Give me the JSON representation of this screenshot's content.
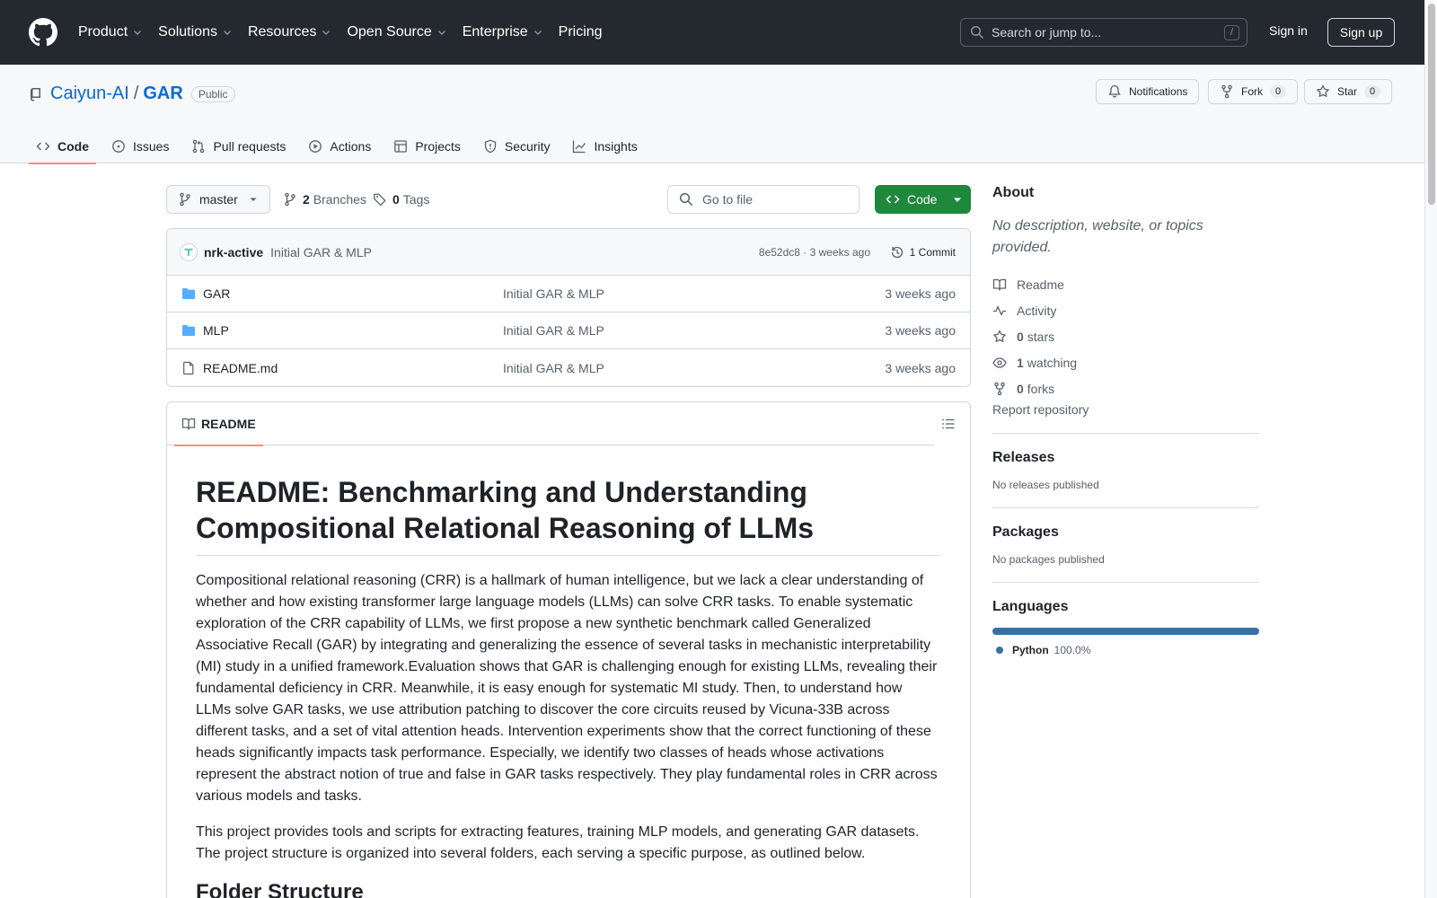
{
  "header": {
    "nav": [
      "Product",
      "Solutions",
      "Resources",
      "Open Source",
      "Enterprise",
      "Pricing"
    ],
    "search_placeholder": "Search or jump to...",
    "search_key": "/",
    "signin": "Sign in",
    "signup": "Sign up"
  },
  "repo": {
    "owner": "Caiyun-AI",
    "separator": "/",
    "name": "GAR",
    "visibility": "Public",
    "notifications": "Notifications",
    "fork_label": "Fork",
    "fork_count": "0",
    "star_label": "Star",
    "star_count": "0",
    "tabs": [
      "Code",
      "Issues",
      "Pull requests",
      "Actions",
      "Projects",
      "Security",
      "Insights"
    ]
  },
  "toolbar": {
    "branch": "master",
    "branches_count": "2",
    "branches_label": "Branches",
    "tags_count": "0",
    "tags_label": "Tags",
    "goto_placeholder": "Go to file",
    "code_button": "Code"
  },
  "commit": {
    "author": "nrk-active",
    "message": "Initial GAR & MLP",
    "hash_time": "8e52dc8 · 3 weeks ago",
    "count": "1 Commit"
  },
  "files": [
    {
      "name": "GAR",
      "type": "folder",
      "message": "Initial GAR & MLP",
      "date": "3 weeks ago"
    },
    {
      "name": "MLP",
      "type": "folder",
      "message": "Initial GAR & MLP",
      "date": "3 weeks ago"
    },
    {
      "name": "README.md",
      "type": "file",
      "message": "Initial GAR & MLP",
      "date": "3 weeks ago"
    }
  ],
  "readme": {
    "tab": "README",
    "title": "README: Benchmarking and Understanding Compositional Relational Reasoning of LLMs",
    "p1": "Compositional relational reasoning (CRR) is a hallmark of human intelligence, but we lack a clear understanding of whether and how existing transformer large language models (LLMs) can solve CRR tasks. To enable systematic exploration of the CRR capability of LLMs, we first propose a new synthetic benchmark called Generalized Associative Recall (GAR) by integrating and generalizing the essence of several tasks in mechanistic interpretability (MI) study in a unified framework.Evaluation shows that GAR is challenging enough for existing LLMs, revealing their fundamental deficiency in CRR. Meanwhile, it is easy enough for systematic MI study. Then, to understand how LLMs solve GAR tasks, we use attribution patching to discover the core circuits reused by Vicuna-33B across different tasks, and a set of vital attention heads. Intervention experiments show that the correct functioning of these heads significantly impacts task performance. Especially, we identify two classes of heads whose activations represent the abstract notion of true and false in GAR tasks respectively. They play fundamental roles in CRR across various models and tasks.",
    "p2": "This project provides tools and scripts for extracting features, training MLP models, and generating GAR datasets. The project structure is organized into several folders, each serving a specific purpose, as outlined below.",
    "h2": "Folder Structure"
  },
  "sidebar": {
    "about": "About",
    "description": "No description, website, or topics provided.",
    "readme": "Readme",
    "activity": "Activity",
    "stars_count": "0",
    "stars_label": "stars",
    "watching_count": "1",
    "watching_label": "watching",
    "forks_count": "0",
    "forks_label": "forks",
    "report": "Report repository",
    "releases": "Releases",
    "releases_note": "No releases published",
    "packages": "Packages",
    "packages_note": "No packages published",
    "languages": "Languages",
    "lang_name": "Python",
    "lang_pct": "100.0%",
    "lang_color": "#3572a5"
  }
}
